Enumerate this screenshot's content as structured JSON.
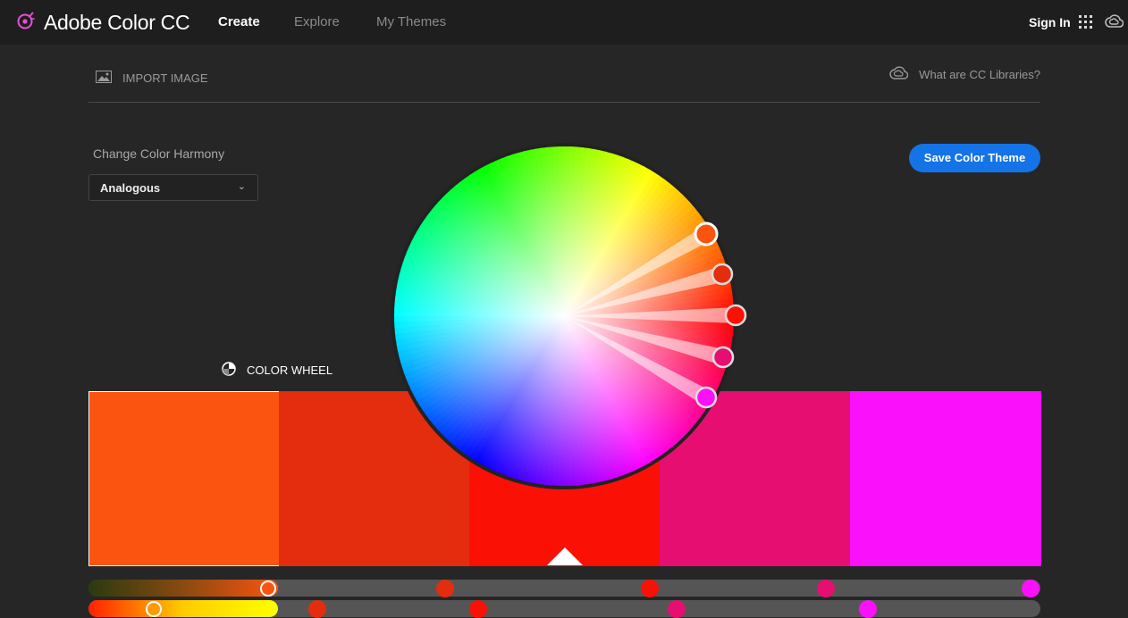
{
  "app": {
    "title": "Adobe Color CC"
  },
  "nav": {
    "create": "Create",
    "explore": "Explore",
    "my_themes": "My Themes"
  },
  "header": {
    "sign_in": "Sign In"
  },
  "tabs": {
    "import_image": "IMPORT IMAGE",
    "color_wheel": "COLOR WHEEL"
  },
  "libraries_link": "What are CC Libraries?",
  "harmony": {
    "label": "Change Color Harmony",
    "selected": "Analogous"
  },
  "save_button": "Save Color Theme",
  "theme": {
    "swatches": [
      {
        "color": "#FA5410",
        "selected": true
      },
      {
        "color": "#E42C0E",
        "selected": false
      },
      {
        "color": "#FA1005",
        "selected": false
      },
      {
        "color": "#E60E70",
        "selected": false
      },
      {
        "color": "#FA10FA",
        "selected": false
      }
    ],
    "base_index": 2
  },
  "colors": {
    "accent": "#1473e6",
    "background": "#262626",
    "topbar": "#1e1e1e"
  },
  "icons": [
    "adobe-color-logo-icon",
    "image-icon",
    "color-wheel-icon",
    "creative-cloud-icon",
    "app-grid-icon",
    "chevron-down-icon"
  ]
}
